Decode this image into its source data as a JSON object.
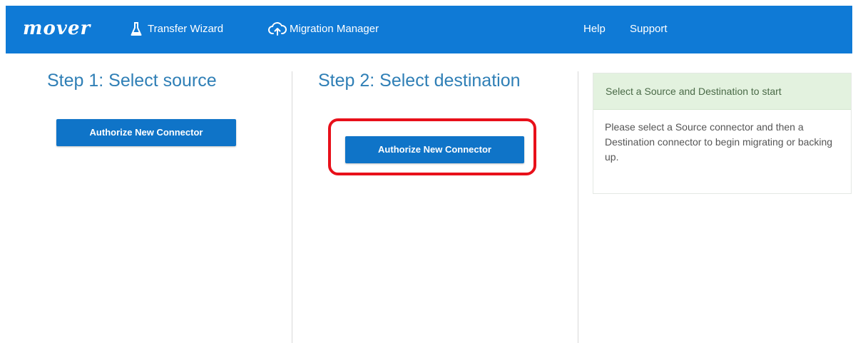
{
  "colors": {
    "navbar_bg": "#0f7ad6",
    "step_title": "#2f7fb6",
    "primary_button": "#0f74c8",
    "highlight": "#e8101a",
    "info_header_bg": "#e3f2df"
  },
  "nav": {
    "logo": "mover",
    "items": [
      {
        "label": "Transfer Wizard",
        "icon": "flask-icon"
      },
      {
        "label": "Migration Manager",
        "icon": "cloud-upload-icon"
      },
      {
        "label": "Help"
      },
      {
        "label": "Support"
      }
    ]
  },
  "steps": [
    {
      "title": "Step 1: Select source",
      "button_label": "Authorize New Connector"
    },
    {
      "title": "Step 2: Select destination",
      "button_label": "Authorize New Connector",
      "highlighted": true
    }
  ],
  "info_panel": {
    "header": "Select a Source and Destination to start",
    "body": "Please select a Source connector and then a Destination connector to begin migrating or backing up."
  }
}
